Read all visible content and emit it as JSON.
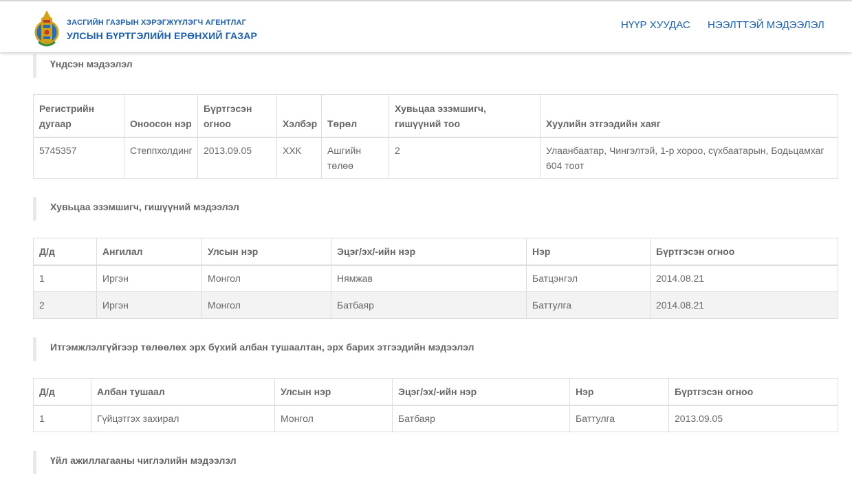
{
  "header": {
    "agency": "ЗАСГИЙН ГАЗРЫН ХЭРЭГЖҮҮЛЭГЧ АГЕНТЛАГ",
    "organization": "УЛСЫН БҮРТГЭЛИЙН ЕРӨНХИЙ ГАЗАР",
    "nav": {
      "home": "НҮҮР ХУУДАС",
      "faq": "НЭЭЛТТЭЙ МЭДЭЭЛЭЛ"
    }
  },
  "basic": {
    "title": "Үндсэн мэдээлэл",
    "columns": [
      "Регистрийн дугаар",
      "Оноосон нэр",
      "Бүртгэсэн огноо",
      "Хэлбэр",
      "Төрөл",
      "Хувьцаа эзэмшигч, гишүүний тоо",
      "Хуулийн этгээдийн хаяг"
    ],
    "row": [
      "5745357",
      "Степпхолдинг",
      "2013.09.05",
      "ХХК",
      "Ашгийн төлөө",
      "2",
      "Улаанбаатар, Чингэлтэй, 1-р хороо, сүхбаатарын, Бодьцамхаг 604 тоот"
    ]
  },
  "shareholders": {
    "title": "Хувьцаа эзэмшигч, гишүүний мэдээлэл",
    "columns": [
      "Д/д",
      "Ангилал",
      "Улсын нэр",
      "Эцэг/эх/-ийн нэр",
      "Нэр",
      "Бүртгэсэн огноо"
    ],
    "rows": [
      [
        "1",
        "Иргэн",
        "Монгол",
        "Нямжав",
        "Батцэнгэл",
        "2014.08.21"
      ],
      [
        "2",
        "Иргэн",
        "Монгол",
        "Батбаяр",
        "Баттулга",
        "2014.08.21"
      ]
    ]
  },
  "authorized": {
    "title": "Итгэмжлэлгүйгээр төлөөлөх эрх бүхий албан тушаалтан, эрх барих этгээдийн мэдээлэл",
    "columns": [
      "Д/д",
      "Албан тушаал",
      "Улсын нэр",
      "Эцэг/эх/-ийн нэр",
      "Нэр",
      "Бүртгэсэн огноо"
    ],
    "rows": [
      [
        "1",
        "Гүйцэтгэх захирал",
        "Монгол",
        "Батбаяр",
        "Баттулга",
        "2013.09.05"
      ]
    ]
  },
  "activity": {
    "title": "Үйл ажиллагааны чиглэлийн мэдээлэл"
  },
  "colors": {
    "brand": "#1a5fb4",
    "gold": "#d4a017",
    "text": "#666666",
    "border": "#dddddd"
  }
}
